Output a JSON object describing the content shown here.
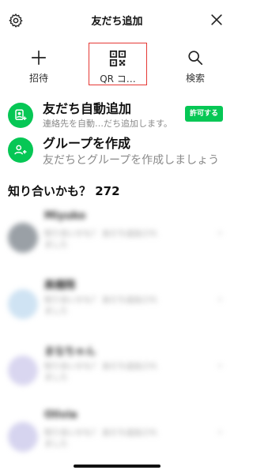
{
  "header": {
    "title": "友だち追加"
  },
  "actions": [
    {
      "label": "招待"
    },
    {
      "label": "QR コ…"
    },
    {
      "label": "検索"
    }
  ],
  "auto_add": {
    "title": "友だち自動追加",
    "subtitle": "連絡先を自動…だち追加します。",
    "button": "許可する"
  },
  "group": {
    "title": "グループを作成",
    "subtitle": "友だちとグループを作成しましょう"
  },
  "section": {
    "title": "知り合いかも？ 272"
  },
  "friends": [
    {
      "name": "Miyuko",
      "desc": "知り合いかも？ 友だち追加されました",
      "avatar_color": "#9aa0a6"
    },
    {
      "name": "高橋翔",
      "desc": "知り合いかも？ 友だち追加されました",
      "avatar_color": "#cfe3f3"
    },
    {
      "name": "まなちゃん",
      "desc": "知り合いかも？ 友だち追加されました",
      "avatar_color": "#d9d6f0"
    },
    {
      "name": "Olivia",
      "desc": "知り合いかも？ 友だち追加されました",
      "avatar_color": "#d6d4ef"
    }
  ],
  "colors": {
    "accent": "#06c755",
    "highlight_border": "#e53935"
  }
}
